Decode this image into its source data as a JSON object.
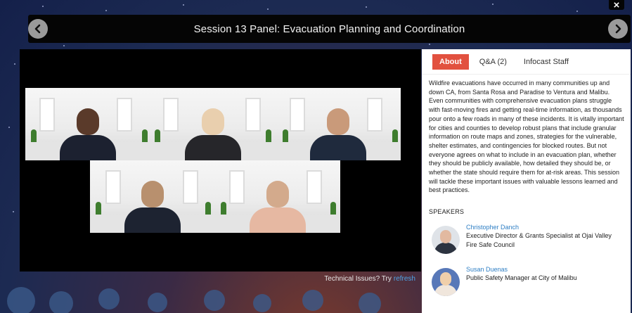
{
  "session": {
    "title": "Session 13 Panel: Evacuation Planning and Coordination"
  },
  "player": {
    "tech_issues_text": "Technical Issues? Try",
    "refresh_link": "refresh"
  },
  "panel": {
    "tabs": [
      {
        "label": "About",
        "active": true
      },
      {
        "label": "Q&A (2)",
        "active": false
      },
      {
        "label": "Infocast Staff",
        "active": false
      }
    ],
    "about_text": "Wildfire evacuations have occurred in many communities up and down CA, from Santa Rosa and Paradise to Ventura and Malibu. Even communities with comprehensive evacuation plans struggle with fast-moving fires and getting real-time information, as thousands pour onto a few roads in many of these incidents. It is vitally important for cities and counties to develop robust plans that include granular information on route maps and zones, strategies for the vulnerable, shelter estimates, and contingencies for blocked routes. But not everyone agrees on what to include in an evacuation plan, whether they should be publicly available, how detailed they should be, or whether the state should require them for at-risk areas. This session will tackle these important issues with valuable lessons learned and best practices.",
    "speakers_heading": "SPEAKERS",
    "speakers": [
      {
        "name": "Christopher Danch",
        "role": "Executive Director & Grants Specialist at Ojai Valley Fire Safe Council"
      },
      {
        "name": "Susan Duenas",
        "role": "Public Safety Manager at City of Malibu"
      }
    ]
  },
  "colors": {
    "accent_tab": "#e2513f",
    "link": "#2d7ec4",
    "refresh_link": "#4ea3e6"
  },
  "icons": {
    "prev": "chevron-left-icon",
    "next": "chevron-right-icon",
    "close": "close-icon"
  }
}
